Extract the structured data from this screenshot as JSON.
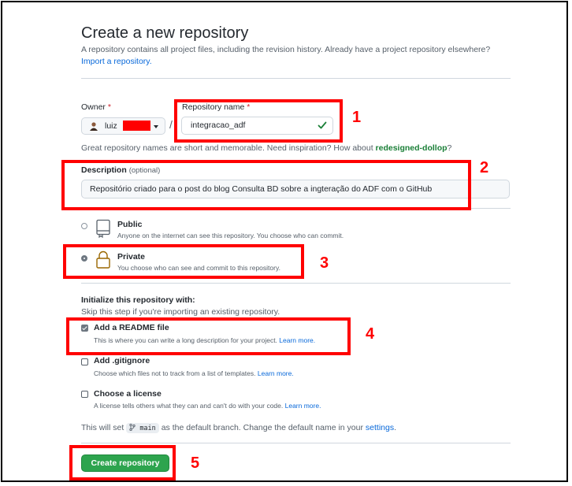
{
  "header": {
    "title": "Create a new repository",
    "subtitle": "A repository contains all project files, including the revision history. Already have a project repository elsewhere?",
    "import_link": "Import a repository."
  },
  "owner": {
    "label": "Owner",
    "required_mark": "*",
    "name_visible": "luiz"
  },
  "separator": "/",
  "repo_name": {
    "label": "Repository name",
    "required_mark": "*",
    "value": "integracao_adf"
  },
  "name_hint": {
    "text": "Great repository names are short and memorable. Need inspiration? How about",
    "suggestion": "redesigned-dollop",
    "end": "?"
  },
  "description": {
    "label": "Description",
    "optional": "(optional)",
    "value": "Repositório criado para o post do blog Consulta BD sobre a ingteração do ADF com o GitHub"
  },
  "visibility": {
    "public": {
      "title": "Public",
      "desc": "Anyone on the internet can see this repository. You choose who can commit."
    },
    "private": {
      "title": "Private",
      "desc": "You choose who can see and commit to this repository.",
      "selected": true
    }
  },
  "initialize": {
    "title": "Initialize this repository with:",
    "subtitle": "Skip this step if you're importing an existing repository.",
    "readme": {
      "label": "Add a README file",
      "desc": "This is where you can write a long description for your project.",
      "link": "Learn more.",
      "checked": true
    },
    "gitignore": {
      "label": "Add .gitignore",
      "desc": "Choose which files not to track from a list of templates.",
      "link": "Learn more.",
      "checked": false
    },
    "license": {
      "label": "Choose a license",
      "desc": "A license tells others what they can and can't do with your code.",
      "link": "Learn more.",
      "checked": false
    }
  },
  "branch": {
    "prefix": "This will set",
    "branch_name": "main",
    "middle": "as the default branch. Change the default name in your",
    "settings_link": "settings",
    "end": "."
  },
  "create_button": "Create repository",
  "annotations": [
    "1",
    "2",
    "3",
    "4",
    "5"
  ],
  "colors": {
    "annotation": "#ff0000",
    "primary_button": "#2da44e",
    "link": "#0969da",
    "suggestion": "#1a7f37"
  }
}
